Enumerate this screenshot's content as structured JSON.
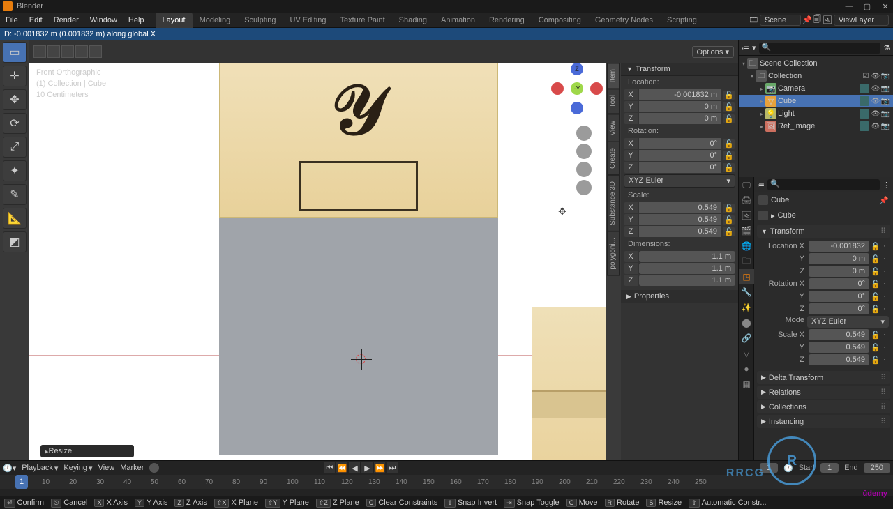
{
  "app": {
    "title": "Blender"
  },
  "menu": [
    "File",
    "Edit",
    "Render",
    "Window",
    "Help"
  ],
  "workspaces": [
    "Layout",
    "Modeling",
    "Sculpting",
    "UV Editing",
    "Texture Paint",
    "Shading",
    "Animation",
    "Rendering",
    "Compositing",
    "Geometry Nodes",
    "Scripting"
  ],
  "active_ws": 0,
  "scene": {
    "scene": "Scene",
    "layer": "ViewLayer"
  },
  "status_hdr": "D: -0.001832 m (0.001832 m) along global X",
  "vp_overlay": {
    "l1": "Front Orthographic",
    "l2": "(1) Collection | Cube",
    "l3": "10 Centimeters"
  },
  "vp_options": "Options",
  "resize_op": "Resize",
  "side_tabs": [
    "Item",
    "Tool",
    "View",
    "Create",
    "Substance 3D",
    "polygoni..."
  ],
  "npanel": {
    "transform": "Transform",
    "location": "Location:",
    "rotation": "Rotation:",
    "scale": "Scale:",
    "dimensions": "Dimensions:",
    "loc": {
      "x": "-0.001832 m",
      "y": "0 m",
      "z": "0 m"
    },
    "rot": {
      "x": "0°",
      "y": "0°",
      "z": "0°"
    },
    "rot_mode": "XYZ Euler",
    "scl": {
      "x": "0.549",
      "y": "0.549",
      "z": "0.549"
    },
    "dim": {
      "x": "1.1 m",
      "y": "1.1 m",
      "z": "1.1 m"
    },
    "props": "Properties"
  },
  "outliner": {
    "root": "Scene Collection",
    "coll": "Collection",
    "items": [
      {
        "name": "Camera",
        "ico": "📷",
        "c": "#69a869"
      },
      {
        "name": "Cube",
        "ico": "▽",
        "c": "#e8a23c"
      },
      {
        "name": "Light",
        "ico": "💡",
        "c": "#b8b868"
      },
      {
        "name": "Ref_image",
        "ico": "🖼",
        "c": "#cc6f5f"
      }
    ]
  },
  "props": {
    "bc1": "Cube",
    "bc2": "Cube",
    "transform": "Transform",
    "rows": [
      {
        "l": "Location X",
        "v": "-0.001832"
      },
      {
        "l": "Y",
        "v": "0 m"
      },
      {
        "l": "Z",
        "v": "0 m"
      },
      {
        "l": "Rotation X",
        "v": "0°"
      },
      {
        "l": "Y",
        "v": "0°"
      },
      {
        "l": "Z",
        "v": "0°"
      }
    ],
    "mode_l": "Mode",
    "mode_v": "XYZ Euler",
    "srows": [
      {
        "l": "Scale X",
        "v": "0.549"
      },
      {
        "l": "Y",
        "v": "0.549"
      },
      {
        "l": "Z",
        "v": "0.549"
      }
    ],
    "panels": [
      "Delta Transform",
      "Relations",
      "Collections",
      "Instancing"
    ]
  },
  "timeline": {
    "menus": [
      "Playback",
      "Keying",
      "View",
      "Marker"
    ],
    "cur": "1",
    "start_l": "Start",
    "start": "1",
    "end_l": "End",
    "end": "250",
    "ticks": [
      10,
      20,
      30,
      40,
      50,
      60,
      70,
      80,
      90,
      100,
      110,
      120,
      130,
      140,
      150,
      160,
      170,
      180,
      190,
      200,
      210,
      220,
      230,
      240,
      250
    ]
  },
  "statusbar": [
    {
      "k": "⏎",
      "t": "Confirm"
    },
    {
      "k": "⎋",
      "t": "Cancel"
    },
    {
      "k": "X",
      "t": "X Axis"
    },
    {
      "k": "Y",
      "t": "Y Axis"
    },
    {
      "k": "Z",
      "t": "Z Axis"
    },
    {
      "k": "⇧X",
      "t": "X Plane"
    },
    {
      "k": "⇧Y",
      "t": "Y Plane"
    },
    {
      "k": "⇧Z",
      "t": "Z Plane"
    },
    {
      "k": "C",
      "t": "Clear Constraints"
    },
    {
      "k": "⇧",
      "t": "Snap Invert"
    },
    {
      "k": "⇥",
      "t": "Snap Toggle"
    },
    {
      "k": "G",
      "t": "Move"
    },
    {
      "k": "R",
      "t": "Rotate"
    },
    {
      "k": "S",
      "t": "Resize"
    },
    {
      "k": "⇧",
      "t": "Automatic Constr..."
    }
  ]
}
